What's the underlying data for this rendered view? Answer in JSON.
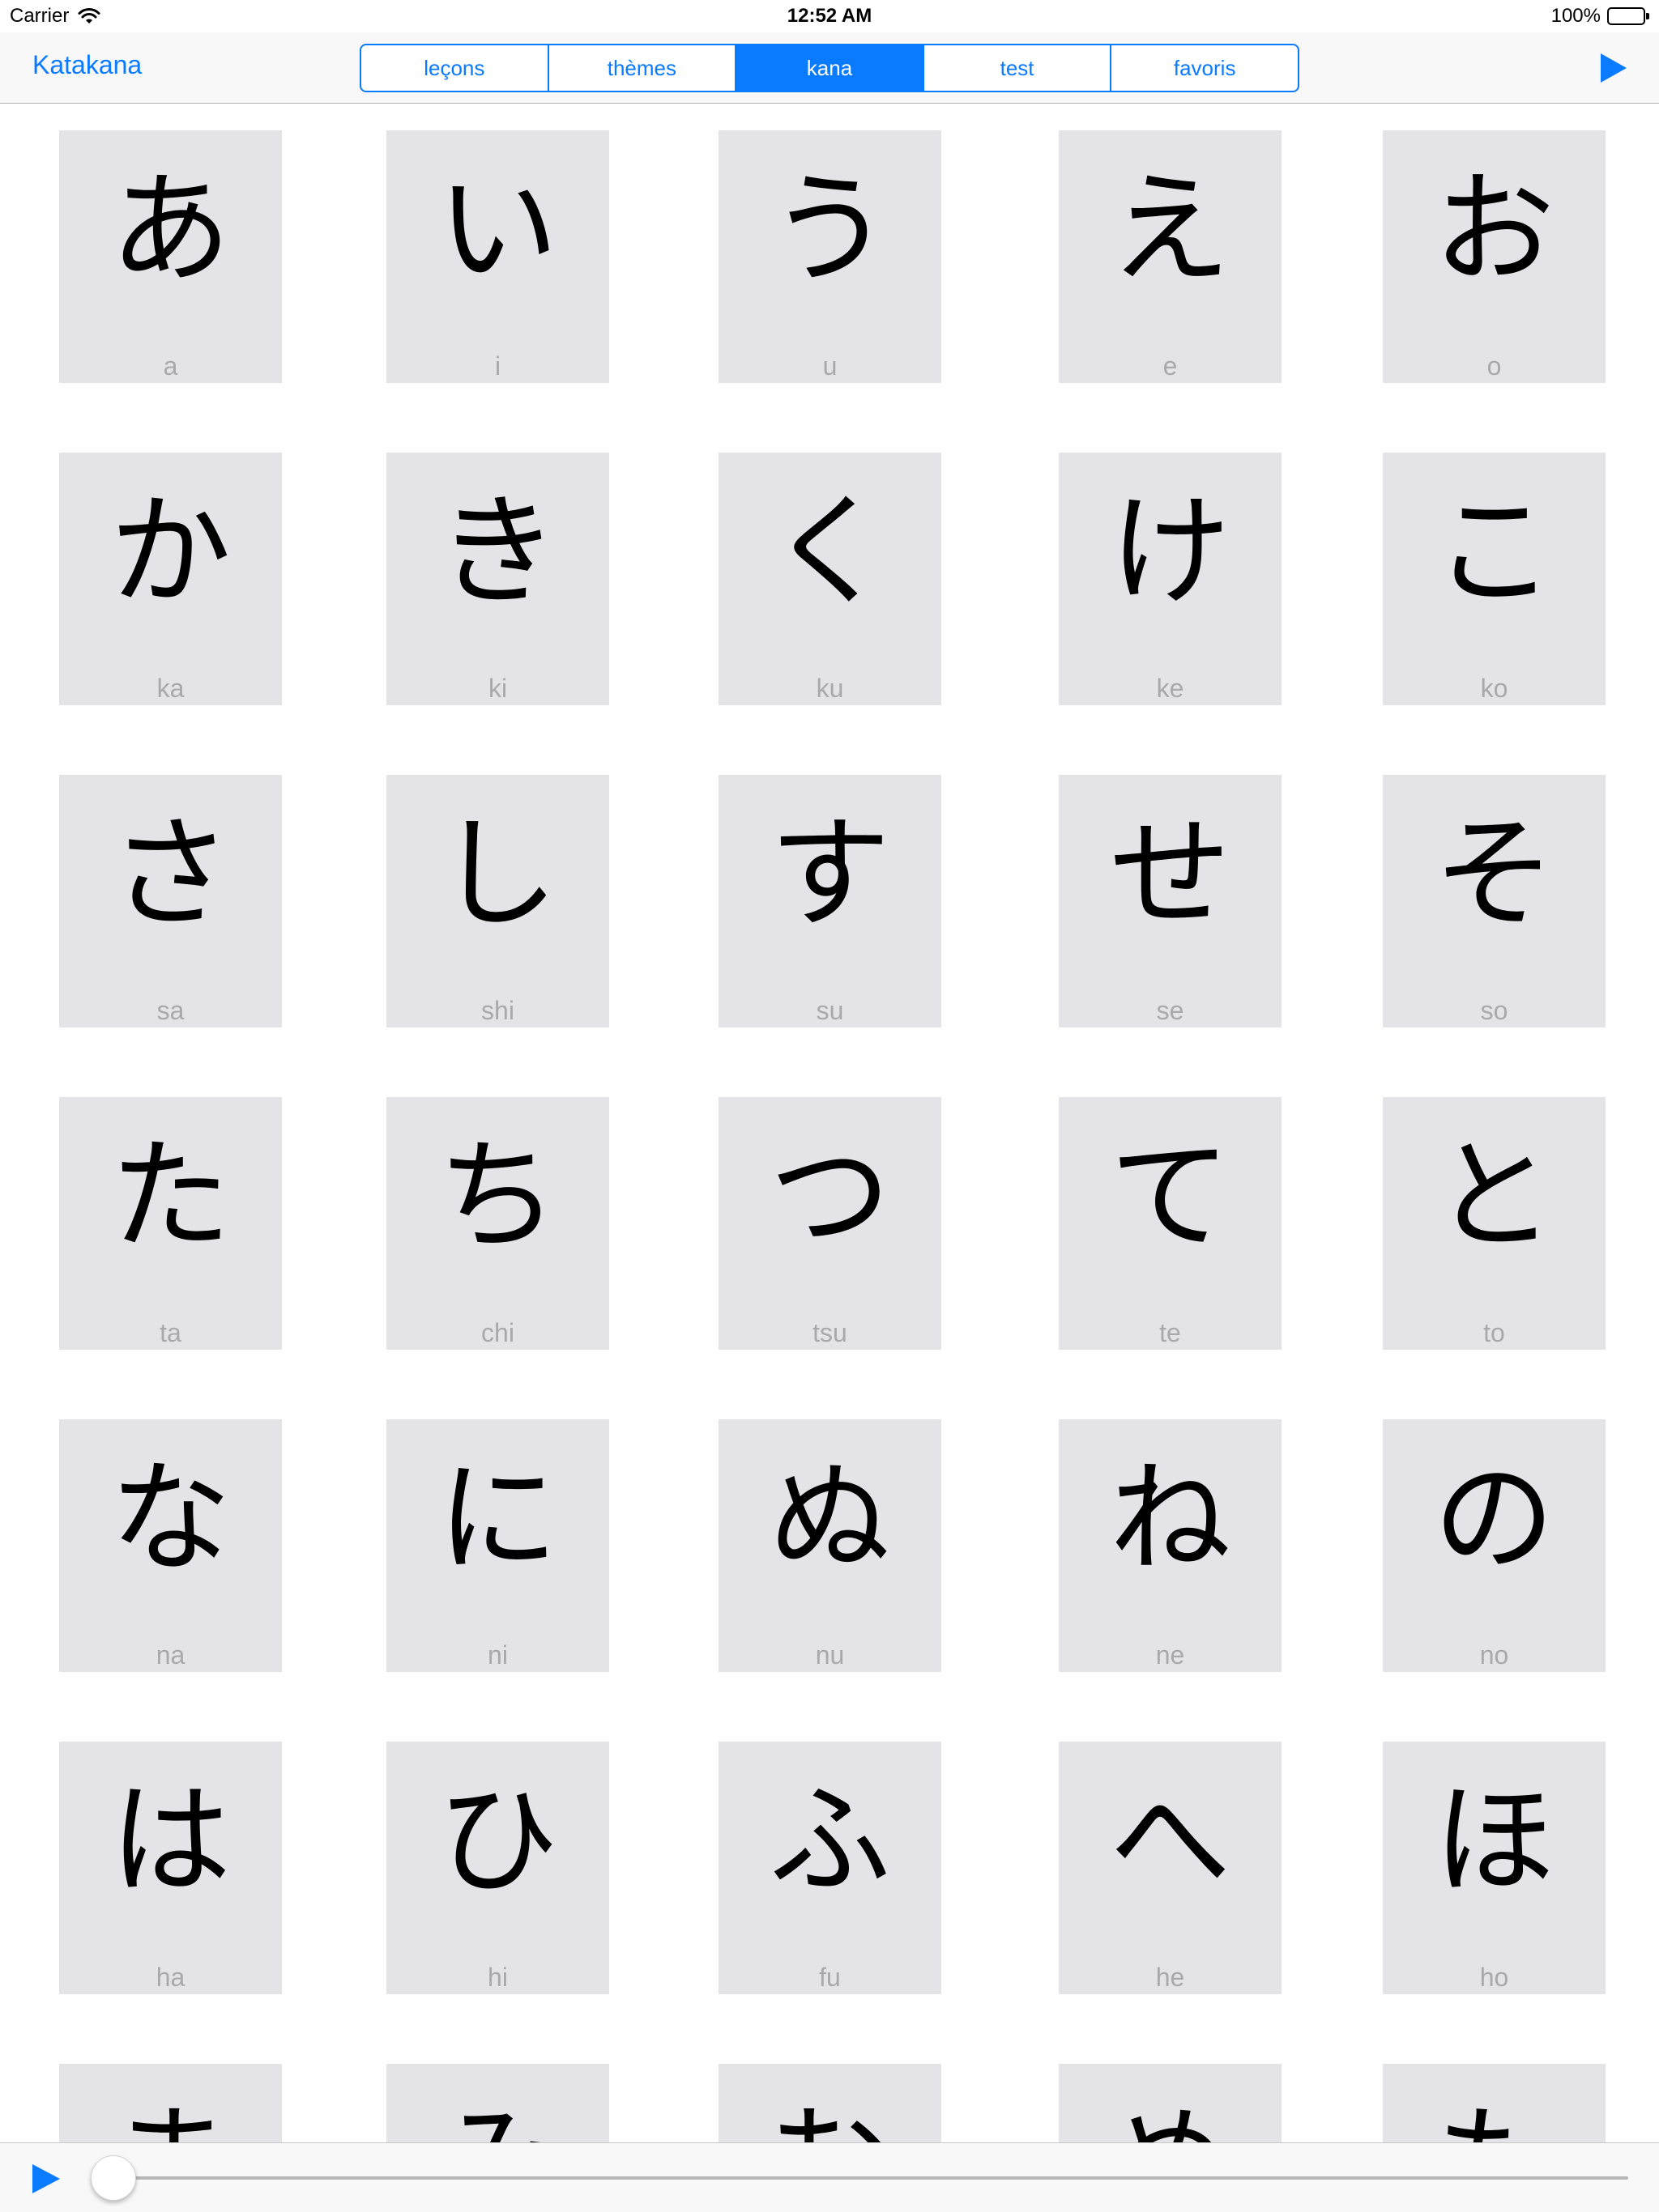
{
  "status_bar": {
    "carrier": "Carrier",
    "time": "12:52 AM",
    "battery": "100%",
    "battery_level": 1.0
  },
  "nav": {
    "back_label": "Katakana",
    "accent_color": "#0a7aff",
    "segments": [
      {
        "label": "leçons",
        "selected": false
      },
      {
        "label": "thèmes",
        "selected": false
      },
      {
        "label": "kana",
        "selected": true
      },
      {
        "label": "test",
        "selected": false
      },
      {
        "label": "favoris",
        "selected": false
      }
    ],
    "play_icon": "play-icon"
  },
  "kana_rows": [
    [
      {
        "kana": "あ",
        "romaji": "a"
      },
      {
        "kana": "い",
        "romaji": "i"
      },
      {
        "kana": "う",
        "romaji": "u"
      },
      {
        "kana": "え",
        "romaji": "e"
      },
      {
        "kana": "お",
        "romaji": "o"
      }
    ],
    [
      {
        "kana": "か",
        "romaji": "ka"
      },
      {
        "kana": "き",
        "romaji": "ki"
      },
      {
        "kana": "く",
        "romaji": "ku"
      },
      {
        "kana": "け",
        "romaji": "ke"
      },
      {
        "kana": "こ",
        "romaji": "ko"
      }
    ],
    [
      {
        "kana": "さ",
        "romaji": "sa"
      },
      {
        "kana": "し",
        "romaji": "shi"
      },
      {
        "kana": "す",
        "romaji": "su"
      },
      {
        "kana": "せ",
        "romaji": "se"
      },
      {
        "kana": "そ",
        "romaji": "so"
      }
    ],
    [
      {
        "kana": "た",
        "romaji": "ta"
      },
      {
        "kana": "ち",
        "romaji": "chi"
      },
      {
        "kana": "つ",
        "romaji": "tsu"
      },
      {
        "kana": "て",
        "romaji": "te"
      },
      {
        "kana": "と",
        "romaji": "to"
      }
    ],
    [
      {
        "kana": "な",
        "romaji": "na"
      },
      {
        "kana": "に",
        "romaji": "ni"
      },
      {
        "kana": "ぬ",
        "romaji": "nu"
      },
      {
        "kana": "ね",
        "romaji": "ne"
      },
      {
        "kana": "の",
        "romaji": "no"
      }
    ],
    [
      {
        "kana": "は",
        "romaji": "ha"
      },
      {
        "kana": "ひ",
        "romaji": "hi"
      },
      {
        "kana": "ふ",
        "romaji": "fu"
      },
      {
        "kana": "へ",
        "romaji": "he"
      },
      {
        "kana": "ほ",
        "romaji": "ho"
      }
    ],
    [
      {
        "kana": "ま",
        "romaji": ""
      },
      {
        "kana": "み",
        "romaji": ""
      },
      {
        "kana": "む",
        "romaji": ""
      },
      {
        "kana": "め",
        "romaji": ""
      },
      {
        "kana": "も",
        "romaji": ""
      }
    ]
  ],
  "player": {
    "play_icon": "play-icon",
    "progress": 0.0
  }
}
